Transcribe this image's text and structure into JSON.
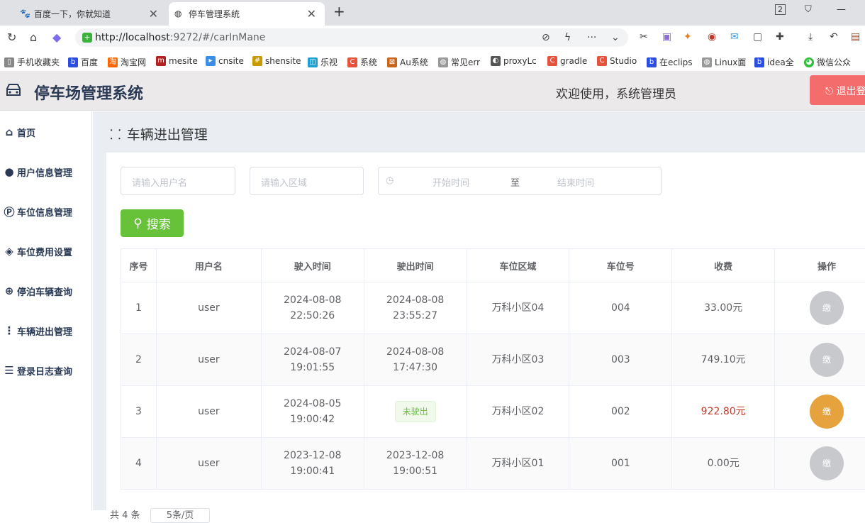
{
  "browser": {
    "tabs": [
      {
        "title": "百度一下，你就知道",
        "icon": "baidu-icon"
      },
      {
        "title": "停车管理系统",
        "icon": "globe-icon"
      }
    ],
    "window_badge": "2",
    "url_host": "http://localhost",
    "url_rest": ":9272/#/carInMane",
    "bookmarks": [
      "手机收藏夹",
      "百度",
      "淘宝网",
      "mesite",
      "cnsite",
      "shensite",
      "乐视",
      "系统",
      "Au系统",
      "常见err",
      "proxyLc",
      "gradle",
      "Studio",
      "在eclips",
      "Linux面",
      "idea全",
      "微信公众"
    ]
  },
  "header": {
    "title": "停车场管理系统",
    "welcome": "欢迎使用，系统管理员",
    "logout_label": "退出登"
  },
  "sidebar": {
    "items": [
      {
        "label": "首页",
        "icon": "home-icon"
      },
      {
        "label": "用户信息管理",
        "icon": "user-icon"
      },
      {
        "label": "车位信息管理",
        "icon": "parking-pin-icon"
      },
      {
        "label": "车位费用设置",
        "icon": "tag-icon"
      },
      {
        "label": "停泊车辆查询",
        "icon": "car-search-icon"
      },
      {
        "label": "车辆进出管理",
        "icon": "scan-icon"
      },
      {
        "label": "登录日志查询",
        "icon": "log-list-icon"
      }
    ]
  },
  "page": {
    "title": "车辆进出管理",
    "filters": {
      "username_placeholder": "请输入用户名",
      "area_placeholder": "请输入区域",
      "start_placeholder": "开始时间",
      "range_sep": "至",
      "end_placeholder": "结束时间"
    },
    "search_label": "搜索",
    "columns": [
      "序号",
      "用户名",
      "驶入时间",
      "驶出时间",
      "车位区域",
      "车位号",
      "收费",
      "操作"
    ],
    "rows": [
      {
        "no": "1",
        "user": "user",
        "in_time": "2024-08-08 22:50:26",
        "out_time": "2024-08-08 23:55:27",
        "area": "万科小区04",
        "space": "004",
        "fee": "33.00元",
        "paid": true
      },
      {
        "no": "2",
        "user": "user",
        "in_time": "2024-08-07 19:01:55",
        "out_time": "2024-08-08 17:47:30",
        "area": "万科小区03",
        "space": "003",
        "fee": "749.10元",
        "paid": true
      },
      {
        "no": "3",
        "user": "user",
        "in_time": "2024-08-05 19:00:42",
        "out_time": "未驶出",
        "area": "万科小区02",
        "space": "002",
        "fee": "922.80元",
        "paid": false
      },
      {
        "no": "4",
        "user": "user",
        "in_time": "2023-12-08 19:00:41",
        "out_time": "2023-12-08 19:00:51",
        "area": "万科小区01",
        "space": "001",
        "fee": "0.00元",
        "paid": true
      }
    ],
    "op_label_paid": "缴",
    "op_label_pay": "缴",
    "pager": {
      "total": "共 4 条",
      "page_size": "5条/页"
    }
  }
}
